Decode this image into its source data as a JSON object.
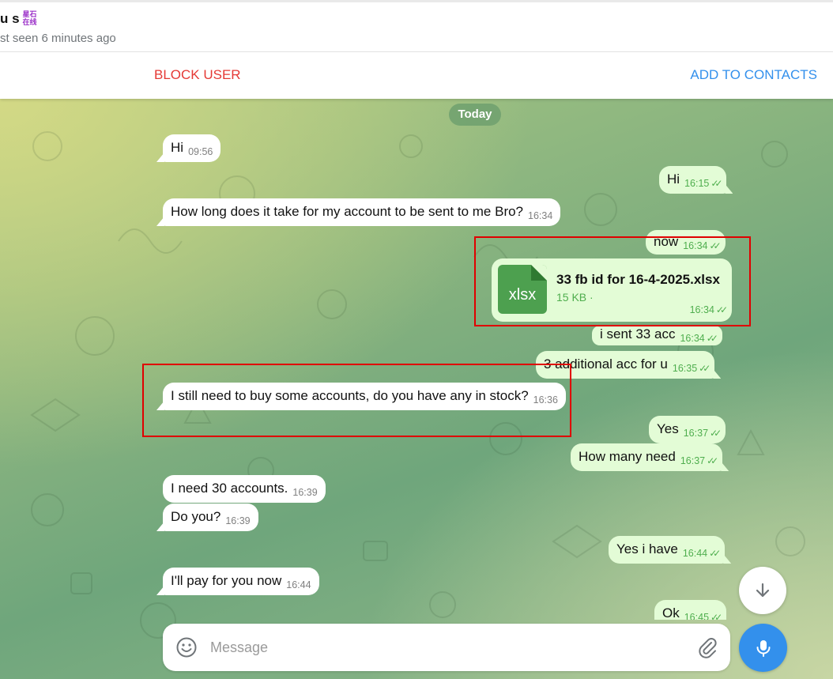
{
  "header": {
    "name": "u s",
    "badge_text": "星石在线",
    "last_seen": "st seen 6 minutes ago"
  },
  "actions": {
    "block_label": "BLOCK USER",
    "add_label": "ADD TO CONTACTS"
  },
  "date_separator": "Today",
  "messages": [
    {
      "dir": "in",
      "text": "Hi",
      "time": "09:56"
    },
    {
      "dir": "out",
      "text": "Hi",
      "time": "16:15"
    },
    {
      "dir": "in",
      "text": "How long does it take for my account to be sent to me Bro?",
      "time": "16:34"
    },
    {
      "dir": "out",
      "text": "now",
      "time": "16:34"
    },
    {
      "dir": "out",
      "type": "file",
      "file_ext": "xlsx",
      "file_name": "33 fb id for 16-4-2025.xlsx",
      "file_size": "15 KB ·",
      "time": "16:34"
    },
    {
      "dir": "out",
      "text": "i sent 33 acc",
      "time": "16:34"
    },
    {
      "dir": "out",
      "text": "3  additional acc for u",
      "time": "16:35"
    },
    {
      "dir": "in",
      "text": "I still need to buy some accounts, do you have any in stock?",
      "time": "16:36"
    },
    {
      "dir": "out",
      "text": "Yes",
      "time": "16:37"
    },
    {
      "dir": "out",
      "text": "How many need",
      "time": "16:37"
    },
    {
      "dir": "in",
      "text": "I need 30 accounts.",
      "time": "16:39"
    },
    {
      "dir": "in",
      "text": "Do you?",
      "time": "16:39"
    },
    {
      "dir": "out",
      "text": "Yes i have",
      "time": "16:44"
    },
    {
      "dir": "in",
      "text": "I'll pay for you now",
      "time": "16:44"
    },
    {
      "dir": "out",
      "text": "Ok",
      "time": "16:45"
    }
  ],
  "composer": {
    "placeholder": "Message"
  },
  "icons": {
    "emoji": "smile-icon",
    "attach": "paperclip-icon",
    "mic": "microphone-icon",
    "scroll_down": "arrow-down-icon"
  },
  "colors": {
    "incoming_bubble": "#ffffff",
    "outgoing_bubble": "#e3fcd6",
    "accent": "#3390ec",
    "danger": "#e53935",
    "highlight_box": "#e00000"
  }
}
